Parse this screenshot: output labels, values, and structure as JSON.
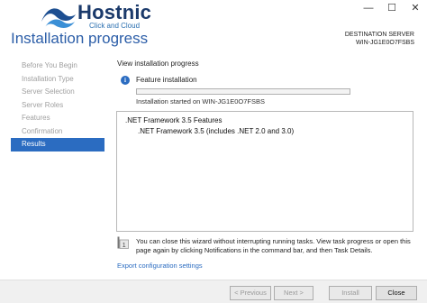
{
  "window": {
    "controls": {
      "minimize": "—",
      "maximize": "☐",
      "close": "✕"
    }
  },
  "logo": {
    "name": "Hostnic",
    "tagline": "Click and Cloud"
  },
  "page_title": "Installation progress",
  "destination": {
    "label": "DESTINATION SERVER",
    "server": "WIN-JG1E0O7FSBS"
  },
  "sidebar": {
    "items": [
      {
        "label": "Before You Begin",
        "active": false
      },
      {
        "label": "Installation Type",
        "active": false
      },
      {
        "label": "Server Selection",
        "active": false
      },
      {
        "label": "Server Roles",
        "active": false
      },
      {
        "label": "Features",
        "active": false
      },
      {
        "label": "Confirmation",
        "active": false
      },
      {
        "label": "Results",
        "active": true
      }
    ]
  },
  "main": {
    "heading": "View installation progress",
    "status_icon": "info-icon",
    "status": "Feature installation",
    "progress_fraction": 0.0,
    "started": "Installation started on WIN-JG1E0O7FSBS",
    "results": {
      "line1": ".NET Framework 3.5 Features",
      "line2": ".NET Framework 3.5 (includes .NET 2.0 and 3.0)"
    },
    "note": "You can close this wizard without interrupting running tasks. View task progress or open this page again by clicking Notifications in the command bar, and then Task Details.",
    "note_icon": "flag-notification-icon",
    "export_link": "Export configuration settings"
  },
  "footer": {
    "previous": "< Previous",
    "next": "Next >",
    "install": "Install",
    "cancel": "Close"
  },
  "colors": {
    "accent": "#2b6cc1",
    "title": "#2c5ea8",
    "progress": "#2bb24c"
  }
}
